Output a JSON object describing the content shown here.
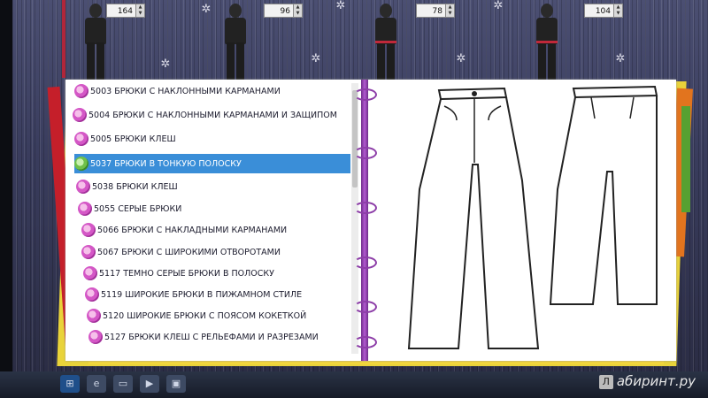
{
  "size_spinners": [
    {
      "value": "164"
    },
    {
      "value": "96"
    },
    {
      "value": "78"
    },
    {
      "value": "104"
    }
  ],
  "models": [
    {
      "label": "model-1"
    },
    {
      "label": "model-2"
    },
    {
      "label": "model-3"
    },
    {
      "label": "model-4"
    }
  ],
  "catalog": {
    "items": [
      {
        "label": "5003 БРЮКИ С НАКЛОННЫМИ КАРМАНАМИ",
        "selected": false
      },
      {
        "label": "5004 БРЮКИ С НАКЛОННЫМИ КАРМАНАМИ И ЗАЩИПОМ",
        "selected": false
      },
      {
        "label": "5005 БРЮКИ КЛЕШ",
        "selected": false
      },
      {
        "label": "5037 БРЮКИ В ТОНКУЮ ПОЛОСКУ",
        "selected": true
      },
      {
        "label": "5038 БРЮКИ КЛЕШ",
        "selected": false
      },
      {
        "label": "5055 СЕРЫЕ БРЮКИ",
        "selected": false
      },
      {
        "label": "5066 БРЮКИ С НАКЛАДНЫМИ КАРМАНАМИ",
        "selected": false
      },
      {
        "label": "5067 БРЮКИ С ШИРОКИМИ ОТВОРОТАМИ",
        "selected": false
      },
      {
        "label": "5117 ТЕМНО СЕРЫЕ БРЮКИ В ПОЛОСКУ",
        "selected": false
      },
      {
        "label": "5119 ШИРОКИЕ БРЮКИ В ПИЖАМНОМ СТИЛЕ",
        "selected": false
      },
      {
        "label": "5120 ШИРОКИЕ БРЮКИ С ПОЯСОМ КОКЕТКОЙ",
        "selected": false
      },
      {
        "label": "5127 БРЮКИ КЛЕШ С РЕЛЬЕФАМИ И РАЗРЕЗАМИ",
        "selected": false
      }
    ]
  },
  "watermark": {
    "text": "абиринт.ру",
    "badge": "Л"
  },
  "colors": {
    "selection": "#3a8ed8",
    "spine": "#8d3ea8",
    "book_yellow": "#e9d33a"
  },
  "icons": {
    "gear": "gear-icon",
    "bullet": "flower-bullet-icon"
  }
}
